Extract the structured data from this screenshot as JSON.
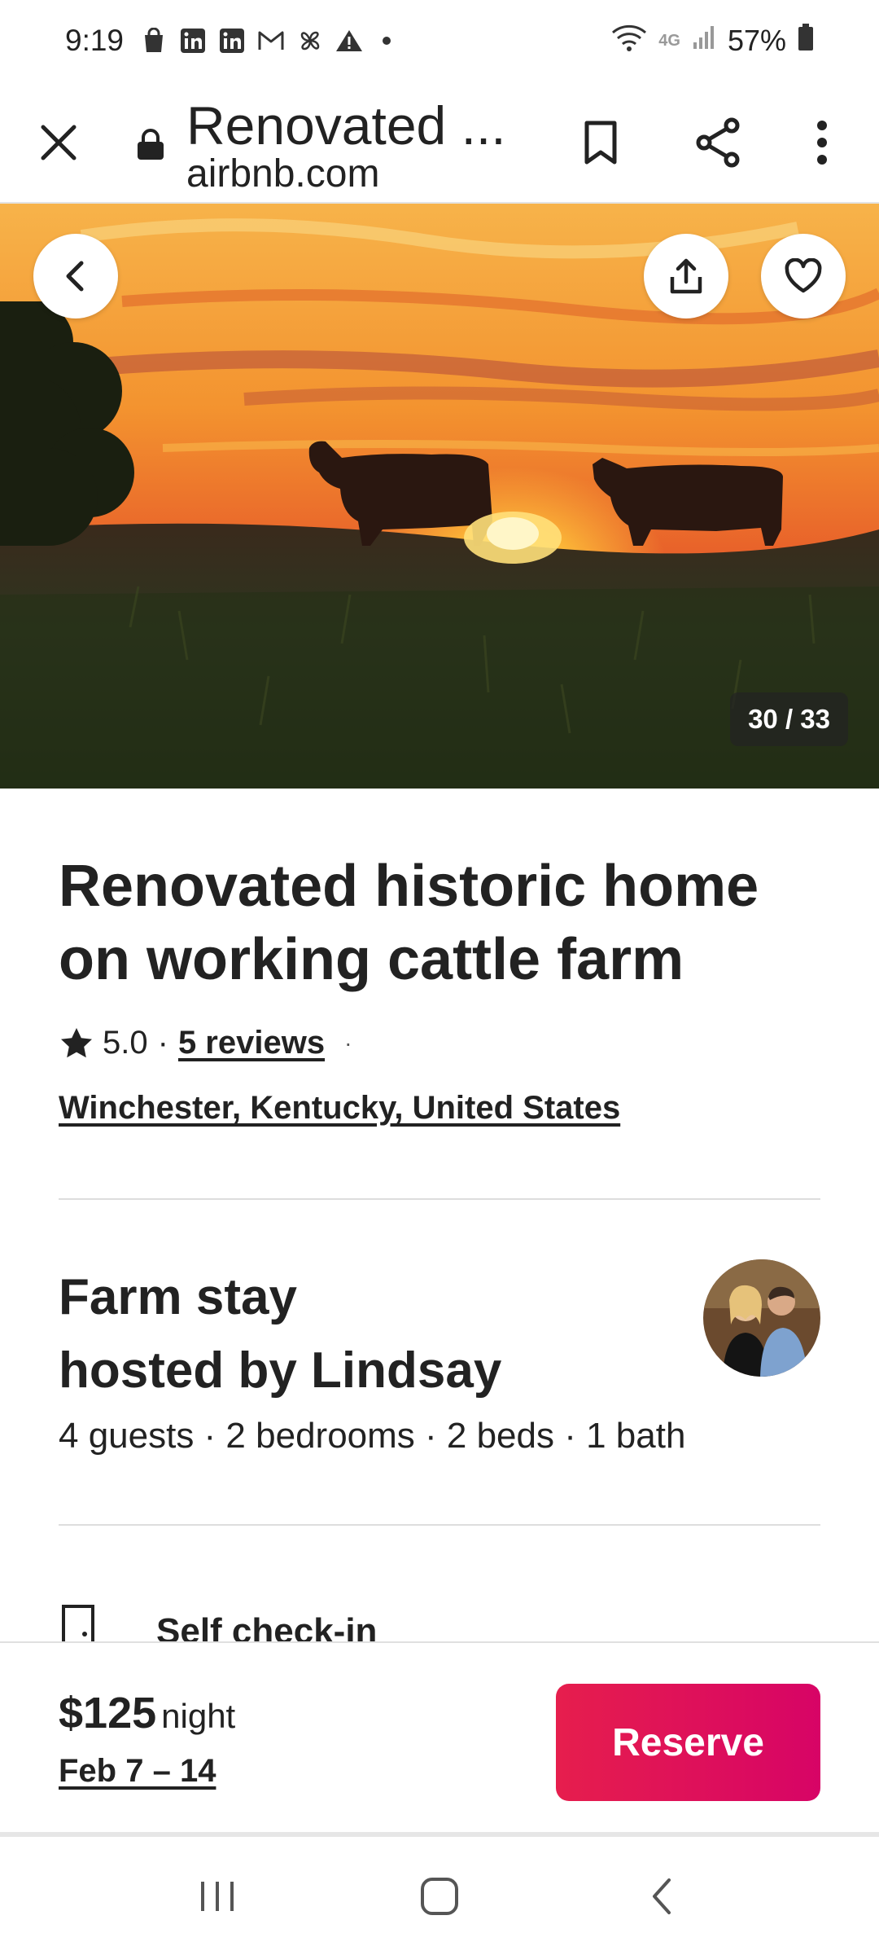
{
  "status_bar": {
    "time": "9:19",
    "network": "4G",
    "battery": "57%"
  },
  "browser": {
    "page_title": "Renovated ...",
    "domain": "airbnb.com"
  },
  "hero": {
    "photo_counter": "30 / 33"
  },
  "listing": {
    "title": "Renovated historic home on working cattle farm",
    "rating": "5.0",
    "rating_sep": "·",
    "reviews": "5 reviews",
    "reviews_trailing": "·",
    "location": "Winchester, Kentucky, United States"
  },
  "host": {
    "title_line1": "Farm stay",
    "title_line2": "hosted by Lindsay",
    "specs": "4 guests · 2 bedrooms · 2 beds · 1 bath"
  },
  "features": [
    {
      "label": "Self check-in",
      "icon": "door-icon"
    }
  ],
  "booking": {
    "price": "$125",
    "per": "night",
    "dates": "Feb 7 – 14",
    "reserve_label": "Reserve"
  },
  "colors": {
    "accent": "#E61E4D",
    "text": "#222222",
    "divider": "#DDDDDD"
  },
  "icons": [
    "close-icon",
    "lock-icon",
    "bookmark-icon",
    "share-icon",
    "more-vert-icon",
    "back-icon",
    "upload-share-icon",
    "heart-icon",
    "star-icon",
    "door-icon",
    "recents-icon",
    "home-icon",
    "nav-back-icon"
  ]
}
